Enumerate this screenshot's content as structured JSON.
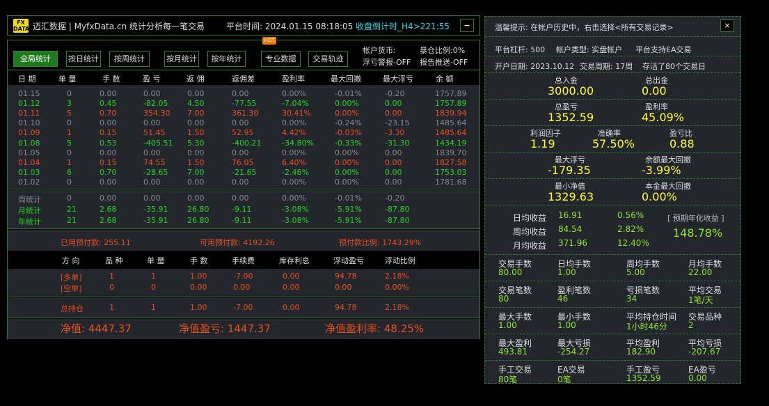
{
  "title": {
    "logo": "FX DATA",
    "app": "迈汇数据 | MyfxData.cn  统计分析每一笔交易",
    "time_label": "平台时间: 2024.01.15 08:18:05",
    "countdown": "收盘倒计时_H4>221:55",
    "min": "−"
  },
  "toolbar": {
    "buttons": [
      "全局统计",
      "按日统计",
      "按周统计",
      "按月统计",
      "按年统计",
      "专业数据",
      "交易轨迹"
    ],
    "active": 0,
    "hot": "HOT",
    "currency": "帐户货币:",
    "exposure": "暴仓比例:0%",
    "float_alert": "浮亏警报-OFF",
    "report": "报告推送-OFF"
  },
  "table": {
    "headers": [
      "日 期",
      "单 量",
      "手 数",
      "盈 亏",
      "返 佣",
      "返佣差",
      "盈利率",
      "最大回撤",
      "最大浮亏",
      "余 额"
    ],
    "rows": [
      {
        "c": "g",
        "v": [
          "01.15",
          "0",
          "0.00",
          "0.00",
          "0.00",
          "0.00",
          "0.00%",
          "-0.01%",
          "-0.20",
          "1757.89"
        ]
      },
      {
        "c": "gr",
        "v": [
          "01.12",
          "3",
          "0.45",
          "-82.05",
          "4.50",
          "-77.55",
          "-7.04%",
          "0.00%",
          "0.00",
          "1757.89"
        ]
      },
      {
        "c": "r",
        "v": [
          "01.11",
          "5",
          "0.70",
          "354.30",
          "7.00",
          "361.30",
          "30.41%",
          "0.00%",
          "0.00",
          "1839.94"
        ]
      },
      {
        "c": "g",
        "v": [
          "01.10",
          "0",
          "0.00",
          "0.00",
          "0.00",
          "0.00",
          "0.00%",
          "-0.24%",
          "-23.15",
          "1485.64"
        ]
      },
      {
        "c": "r",
        "v": [
          "01.09",
          "1",
          "0.15",
          "51.45",
          "1.50",
          "52.95",
          "4.42%",
          "-0.03%",
          "-3.30",
          "1485.64"
        ]
      },
      {
        "c": "gr",
        "v": [
          "01.08",
          "5",
          "0.53",
          "-405.51",
          "5.30",
          "-400.21",
          "-34.80%",
          "-0.33%",
          "-31.30",
          "1434.19"
        ]
      },
      {
        "c": "g",
        "v": [
          "01.05",
          "0",
          "0.00",
          "0.00",
          "0.00",
          "0.00",
          "0.00%",
          "0.00%",
          "0.00",
          "1839.70"
        ]
      },
      {
        "c": "r",
        "v": [
          "01.04",
          "1",
          "0.15",
          "74.55",
          "1.50",
          "76.05",
          "6.40%",
          "0.00%",
          "0.00",
          "1827.58"
        ]
      },
      {
        "c": "gr",
        "v": [
          "01.03",
          "6",
          "0.70",
          "-28.65",
          "7.00",
          "-21.65",
          "-2.46%",
          "0.00%",
          "0.00",
          "1753.03"
        ]
      },
      {
        "c": "g",
        "v": [
          "01.02",
          "0",
          "0.00",
          "0.00",
          "0.00",
          "0.00",
          "0.00%",
          "0.00%",
          "0.00",
          "1781.68"
        ]
      }
    ],
    "summary": [
      {
        "c": "g",
        "v": [
          "周统计",
          "0",
          "0.00",
          "0.00",
          "0.00",
          "0.00",
          "0.00%",
          "-0.01%",
          "-0.20"
        ]
      },
      {
        "c": "gr",
        "v": [
          "月统计",
          "21",
          "2.68",
          "-35.91",
          "26.80",
          "-9.11",
          "-3.08%",
          "-5.91%",
          "-87.80"
        ]
      },
      {
        "c": "gr",
        "v": [
          "年统计",
          "21",
          "2.68",
          "-35.91",
          "26.80",
          "-9.11",
          "-3.08%",
          "-5.91%",
          "-87.80"
        ]
      }
    ]
  },
  "margin": {
    "used": "已用预付款: 255.11",
    "free": "可用预付款: 4192.26",
    "ratio": "预付款比例: 1743.29%"
  },
  "positions": {
    "headers": [
      "方 向",
      "品 种",
      "单 量",
      "手 数",
      "手续费",
      "库存利息",
      "浮动盈亏",
      "浮动比例"
    ],
    "rows": [
      [
        "[多单]",
        "1",
        "1",
        "1.00",
        "-7.00",
        "0.00",
        "94.78",
        "2.18%"
      ],
      [
        "[空单]",
        "0",
        "0",
        "0.00",
        "0.00",
        "0.00",
        "0.00",
        "0.00%"
      ]
    ],
    "total": [
      "总持仓",
      "1",
      "1",
      "1.00",
      "-7.00",
      "0.00",
      "94.78",
      "2.18%"
    ]
  },
  "net": {
    "equity": "净值: 4447.37",
    "equity_pl": "净值盈亏: 1447.37",
    "equity_rate": "净值盈利率: 48.25%"
  },
  "right": {
    "tip": "温馨提示: 在帐户历史中，右击选择<所有交易记录>",
    "close": "×",
    "line1": [
      "平台杠杆: 500",
      "帐户类型: 实盘帐户",
      "平台支持EA交易"
    ],
    "line2": [
      "开户日期: 2023.10.12",
      "交易周期: 17周",
      "存活了80个交易日"
    ],
    "big": [
      [
        [
          "总入金",
          "3000.00"
        ],
        [
          "总出金",
          "0.00"
        ]
      ],
      [
        [
          "总盈亏",
          "1352.59"
        ],
        [
          "盈利率",
          "45.09%"
        ]
      ],
      [
        [
          "利润因子",
          "1.19"
        ],
        [
          "准确率",
          "57.50%"
        ],
        [
          "盈亏比",
          "0.88"
        ]
      ],
      [
        [
          "最大浮亏",
          "-179.35"
        ],
        [
          "余额最大回撤",
          "-3.99%"
        ]
      ],
      [
        [
          "最小净值",
          "1329.63"
        ],
        [
          "本金最大回撤",
          "0.00%"
        ]
      ]
    ],
    "avg": [
      [
        "日均收益",
        "16.91",
        "0.56%"
      ],
      [
        "周均收益",
        "84.54",
        "2.82%"
      ],
      [
        "月均收益",
        "371.96",
        "12.40%"
      ]
    ],
    "annual_label": "[ 预期年化收益 ]",
    "annual": "148.78%",
    "grid": [
      [
        [
          "交易手数",
          "80.00"
        ],
        [
          "日均手数",
          "1.00"
        ],
        [
          "周均手数",
          "5.00"
        ],
        [
          "月均手数",
          "22.00"
        ]
      ],
      [
        [
          "交易笔数",
          "80"
        ],
        [
          "盈利笔数",
          "46"
        ],
        [
          "亏损笔数",
          "34"
        ],
        [
          "平均交易",
          "1笔/天"
        ]
      ],
      [
        [
          "最大手数",
          "1.00"
        ],
        [
          "最小手数",
          "1.00"
        ],
        [
          "平均持仓时间",
          "1小时46分"
        ],
        [
          "交易品种",
          "2"
        ]
      ],
      [
        [
          "最大盈利",
          "493.81"
        ],
        [
          "最大亏损",
          "-254.27"
        ],
        [
          "平均盈利",
          "182.90"
        ],
        [
          "平均亏损",
          "-207.67"
        ]
      ],
      [
        [
          "手工交易",
          "80笔"
        ],
        [
          "EA交易",
          "0笔"
        ],
        [
          "手工盈亏",
          "1352.59"
        ],
        [
          "EA盈亏",
          "0.00"
        ]
      ]
    ]
  },
  "colors": {
    "green": "#22d622",
    "red": "#e8501e",
    "yellow": "#ffff33",
    "grey": "#888888",
    "border": "#2f7a2f"
  }
}
